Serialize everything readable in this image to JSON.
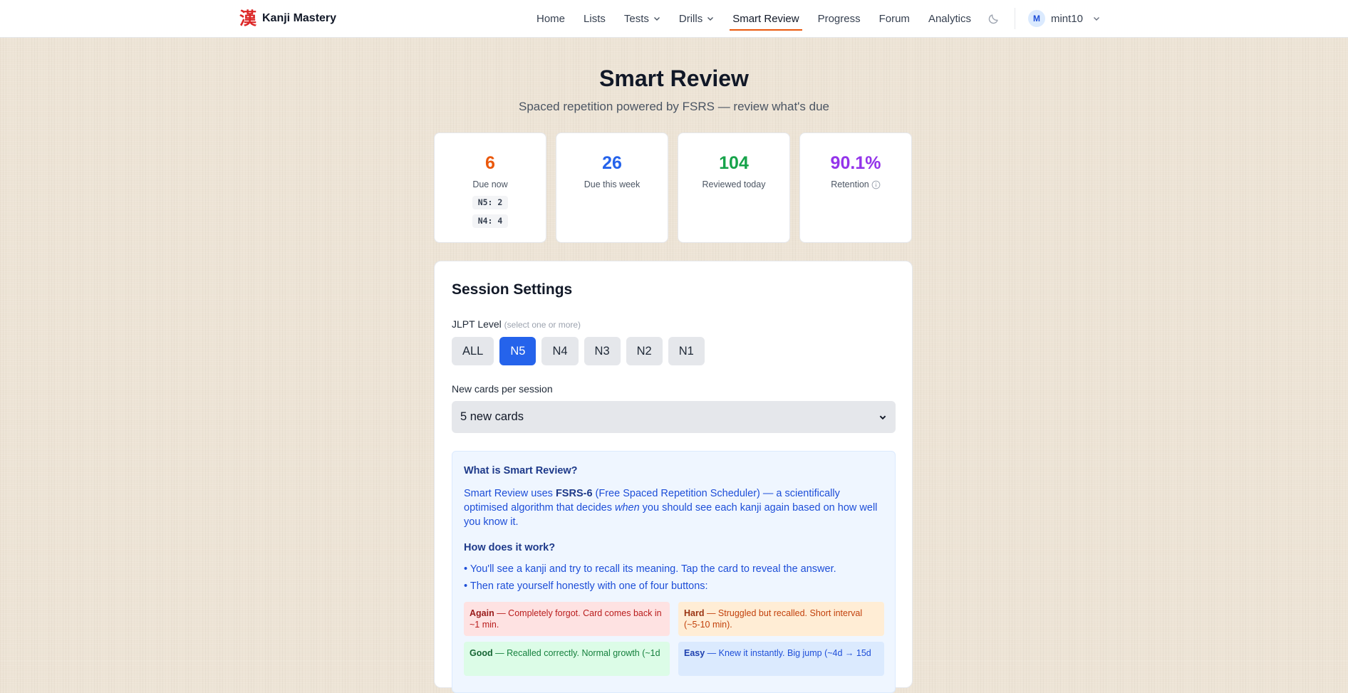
{
  "nav": {
    "brand_logo": "漢",
    "brand_name": "Kanji Mastery",
    "links": [
      {
        "label": "Home"
      },
      {
        "label": "Lists"
      },
      {
        "label": "Tests"
      },
      {
        "label": "Drills"
      },
      {
        "label": "Smart Review"
      },
      {
        "label": "Progress"
      },
      {
        "label": "Forum"
      },
      {
        "label": "Analytics"
      }
    ],
    "active": "Smart Review",
    "theme_icon": "moon-icon",
    "user": {
      "avatar_initial": "M",
      "name": "mint10"
    }
  },
  "header": {
    "title": "Smart Review",
    "subtitle": "Spaced repetition powered by FSRS — review what's due"
  },
  "stats": [
    {
      "value": "6",
      "label": "Due now",
      "color": "#ea580c",
      "breakdown": [
        "N5: 2",
        "N4: 4"
      ]
    },
    {
      "value": "26",
      "label": "Due this week",
      "color": "#2563eb"
    },
    {
      "value": "104",
      "label": "Reviewed today",
      "color": "#16a34a"
    },
    {
      "value": "90.1%",
      "label": "Retention",
      "color": "#9333ea"
    }
  ],
  "settings": {
    "title": "Session Settings",
    "jlpt_label": "JLPT Level",
    "jlpt_hint": "(select one or more)",
    "levels": [
      "ALL",
      "N5",
      "N4",
      "N3",
      "N2",
      "N1"
    ],
    "selected_level": "N5",
    "new_cards_label": "New cards per session",
    "new_cards_value": "5 new cards"
  },
  "info": {
    "what_title": "What is Smart Review?",
    "what_p_pre": "Smart Review uses ",
    "what_p_bold": "FSRS-6",
    "what_p_mid": " (Free Spaced Repetition Scheduler) — a scientifically optimised algorithm that decides ",
    "what_p_em": "when",
    "what_p_post": " you should see each kanji again based on how well you know it.",
    "how_title": "How does it work?",
    "bullets": [
      "• You'll see a kanji and try to recall its meaning. Tap the card to reveal the answer.",
      "• Then rate yourself honestly with one of four buttons:"
    ],
    "ratings": [
      {
        "name": "Again",
        "desc": " — Completely forgot. Card comes back in ~1 min."
      },
      {
        "name": "Hard",
        "desc": " — Struggled but recalled. Short interval (~5-10 min)."
      },
      {
        "name": "Good",
        "desc": " — Recalled correctly. Normal growth (~1d"
      },
      {
        "name": "Easy",
        "desc": " — Knew it instantly. Big jump (~4d → 15d"
      }
    ]
  }
}
